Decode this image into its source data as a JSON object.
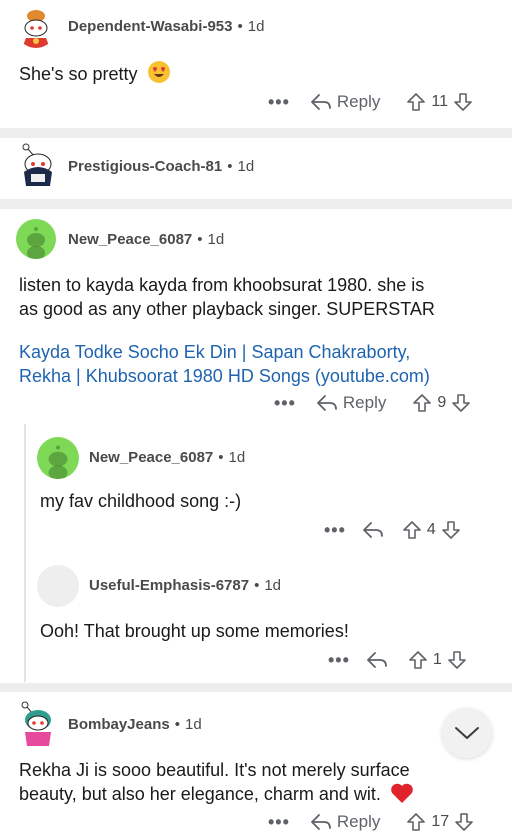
{
  "comments": [
    {
      "username": "Dependent-Wasabi-953",
      "age": "1d",
      "body": "She's so pretty",
      "emoji": "heart-eyes",
      "reply_label": "Reply",
      "score": "11"
    },
    {
      "username": "Prestigious-Coach-81",
      "age": "1d"
    },
    {
      "username": "New_Peace_6087",
      "age": "1d",
      "body_lines": [
        "listen to kayda kayda from khoobsurat 1980. she is",
        "as good as any other playback singer.  SUPERSTAR"
      ],
      "link_lines": [
        "Kayda Todke Socho Ek Din | Sapan Chakraborty,",
        "Rekha | Khubsoorat 1980 HD Songs (youtube.com)"
      ],
      "reply_label": "Reply",
      "score": "9"
    },
    {
      "username": "New_Peace_6087",
      "age": "1d",
      "body": "my fav childhood song :-)",
      "score": "4"
    },
    {
      "username": "Useful-Emphasis-6787",
      "age": "1d",
      "body": "Ooh! That brought up some memories!",
      "score": "1"
    },
    {
      "username": "BombayJeans",
      "age": "1d",
      "body_lines": [
        "Rekha Ji is sooo beautiful. It's not merely surface",
        "beauty, but also her elegance, charm and wit."
      ],
      "emoji": "red-heart",
      "reply_label": "Reply",
      "score": "17"
    }
  ],
  "separator_symbol": "•",
  "more_symbol": "•••",
  "colors": {
    "link": "#1f63b0",
    "separator": "#ededee",
    "meta": "#4a4a4d",
    "icon": "#5f6368"
  },
  "icons": [
    "more-icon",
    "reply-arrow-icon",
    "upvote-icon",
    "downvote-icon",
    "chevron-down-icon"
  ]
}
